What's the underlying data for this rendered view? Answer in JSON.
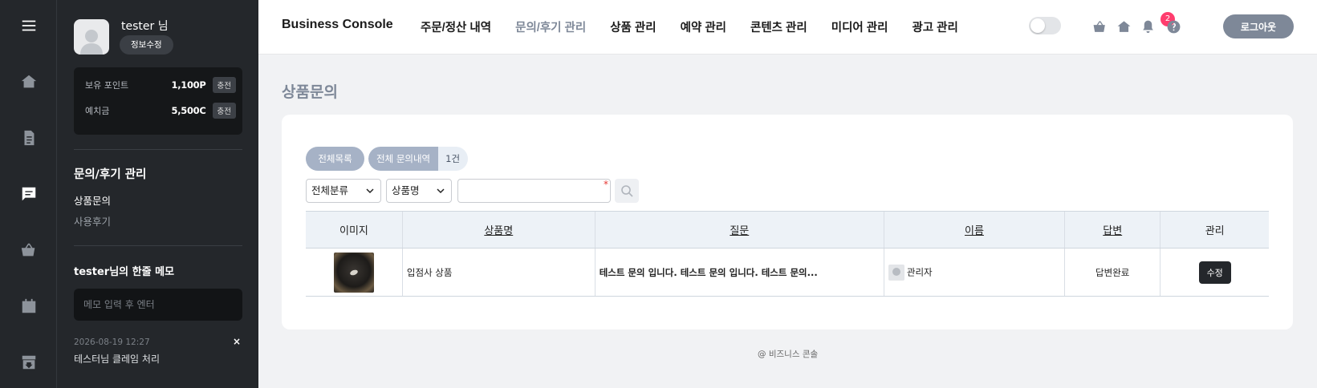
{
  "rail": {
    "items": [
      {
        "icon": "menu-icon"
      },
      {
        "icon": "home-icon"
      },
      {
        "icon": "document-icon"
      },
      {
        "icon": "chat-icon",
        "active": true
      },
      {
        "icon": "basket-icon"
      },
      {
        "icon": "calendar-icon"
      },
      {
        "icon": "archive-icon"
      }
    ]
  },
  "profile": {
    "name": "tester 님",
    "edit_label": "정보수정"
  },
  "points": {
    "rows": [
      {
        "label": "보유 포인트",
        "value": "1,100P",
        "action": "충전"
      },
      {
        "label": "예치금",
        "value": "5,500C",
        "action": "충전"
      }
    ]
  },
  "side_menu": {
    "title": "문의/후기 관리",
    "items": [
      {
        "label": "상품문의",
        "active": true
      },
      {
        "label": "사용후기",
        "active": false
      }
    ]
  },
  "memo": {
    "title": "tester님의 한줄 메모",
    "placeholder": "메모 입력 후 엔터",
    "entries": [
      {
        "date": "2026-08-19 12:27",
        "text": "테스터님 클레임 처리",
        "delete": "×"
      }
    ]
  },
  "header": {
    "brand": "Business Console",
    "nav": [
      {
        "label": "주문/정산 내역"
      },
      {
        "label": "문의/후기 관리",
        "active": true
      },
      {
        "label": "상품 관리"
      },
      {
        "label": "예약 관리"
      },
      {
        "label": "콘텐츠 관리"
      },
      {
        "label": "미디어 관리"
      },
      {
        "label": "광고 관리"
      }
    ],
    "notification_count": "2",
    "logout_label": "로그아웃",
    "accent_color": "#7e8898",
    "badge_color": "#ff3d6e"
  },
  "main": {
    "page_title": "상품문의",
    "filter": {
      "all_list_label": "전체목록",
      "all_inquiries_label": "전체 문의내역",
      "count": "1건",
      "category_select": "전체분류",
      "field_select": "상품명",
      "search_value": "",
      "required_mark": "*"
    },
    "table": {
      "headers": [
        "이미지",
        "상품명",
        "질문",
        "이름",
        "답변",
        "관리"
      ],
      "rows": [
        {
          "product": "입점사 상품",
          "question": "테스트 문의 입니다. 테스트 문의 입니다. 테스트 문의...",
          "name": "관리자",
          "status": "답변완료",
          "action": "수정"
        }
      ]
    }
  },
  "footer": {
    "text": "@ 비즈니스 콘솔"
  }
}
